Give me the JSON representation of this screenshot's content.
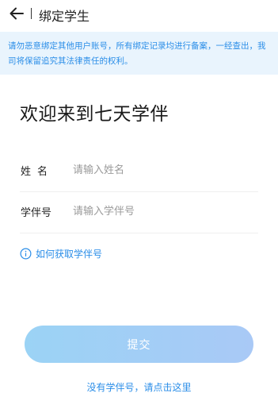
{
  "header": {
    "back_icon": "arrow-left-icon",
    "title": "绑定学生"
  },
  "notice": {
    "text": "请勿恶意绑定其他用户账号，所有绑定记录均进行备案，一经查出，我司将保留追究其法律责任的权利。"
  },
  "welcome": {
    "title": "欢迎来到七天学伴"
  },
  "form": {
    "name_label": "姓名",
    "name_value": "",
    "name_placeholder": "请输入姓名",
    "id_label": "学伴号",
    "id_value": "",
    "id_placeholder": "请输入学伴号"
  },
  "help": {
    "icon": "info-circle-icon",
    "label": "如何获取学伴号"
  },
  "submit": {
    "label": "提交"
  },
  "footer": {
    "link_label": "没有学伴号，请点击这里"
  },
  "colors": {
    "accent": "#2b8ee8",
    "notice_bg": "#e9f4fd",
    "button_gradient_start": "#9bd3f5",
    "button_gradient_end": "#a9c9f6"
  }
}
